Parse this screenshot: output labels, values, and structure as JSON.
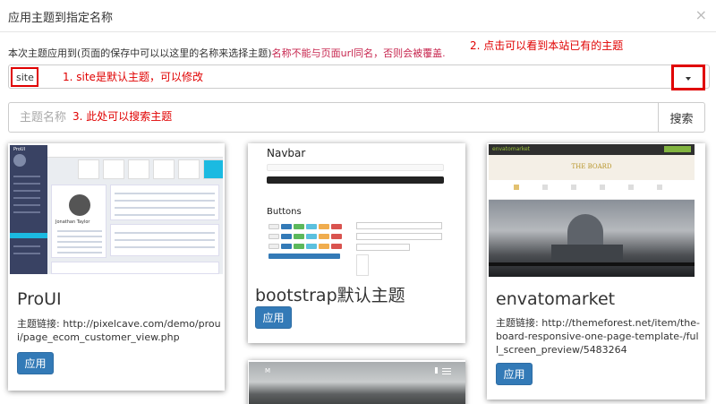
{
  "dialog": {
    "title": "应用主题到指定名称",
    "close_icon": "close-icon"
  },
  "description": {
    "main": "本次主题应用到(页面的保存中可以以这里的名称来选择主题)",
    "warning": "名称不能与页面url同名，否则会被覆盖."
  },
  "theme_name": {
    "value": "site",
    "dropdown_icon": "caret-down-icon"
  },
  "search": {
    "placeholder": "主题名称",
    "button_label": "搜索"
  },
  "annotations": {
    "a1": "1. site是默认主题，可以修改",
    "a2": "2. 点击可以看到本站已有的主题",
    "a3": "3.   此处可以搜索主题",
    "color": "#e00000"
  },
  "themes": [
    {
      "name": "ProUI",
      "link_label": "主题链接:",
      "link": "http://pixelcave.com/demo/proui/page_ecom_customer_view.php",
      "apply_label": "应用",
      "preview": {
        "brand": "ProUI",
        "user_name": "Jonathan Taylor"
      }
    },
    {
      "name": "bootstrap默认主题",
      "apply_label": "应用",
      "preview": {
        "navbar_heading": "Navbar",
        "buttons_heading": "Buttons"
      }
    },
    {
      "name": "envatomarket",
      "link_label": "主题链接:",
      "link": "http://themeforest.net/item/the-board-responsive-one-page-template-/full_screen_preview/5483264",
      "apply_label": "应用",
      "preview": {
        "brand": "envatomarket",
        "heading": "THE BOARD"
      }
    },
    {
      "name": "",
      "preview": {
        "brand": "M"
      }
    }
  ],
  "colors": {
    "primary": "#337ab7",
    "annotation": "#e00000",
    "warning_text": "#c7254e",
    "sidebar": "#394263"
  }
}
